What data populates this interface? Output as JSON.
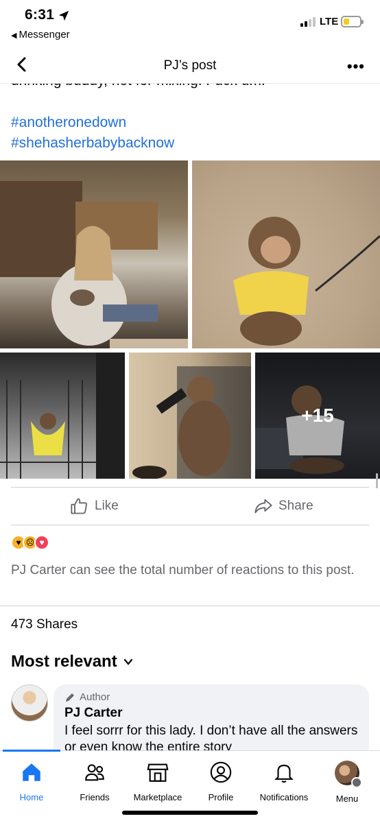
{
  "status_bar": {
    "time": "6:31",
    "back_app": "Messenger",
    "network": "LTE"
  },
  "header": {
    "title": "PJ’s post"
  },
  "post": {
    "truncated_line": "drinking buddy, not for mixing. Fuck um.",
    "hashtags": [
      "#anotheronedown",
      "#shehasherbabybacknow"
    ],
    "more_photos": "+15",
    "like_label": "Like",
    "share_label": "Share",
    "reaction_note": "PJ Carter can see the total number of reactions to this post.",
    "shares_count": "473 Shares",
    "sort_label": "Most relevant"
  },
  "comment": {
    "badge": "Author",
    "name": "PJ Carter",
    "text": "I feel sorrr for this lady.  I don’t have all the answers or even know the entire story"
  },
  "nav": {
    "items": [
      {
        "label": "Home",
        "icon": "home-icon"
      },
      {
        "label": "Friends",
        "icon": "friends-icon"
      },
      {
        "label": "Marketplace",
        "icon": "marketplace-icon"
      },
      {
        "label": "Profile",
        "icon": "profile-icon"
      },
      {
        "label": "Notifications",
        "icon": "bell-icon"
      },
      {
        "label": "Menu",
        "icon": "menu-avatar"
      }
    ]
  },
  "colors": {
    "accent": "#1877f2",
    "hashtag": "#216fdb",
    "muted": "#65676b"
  }
}
